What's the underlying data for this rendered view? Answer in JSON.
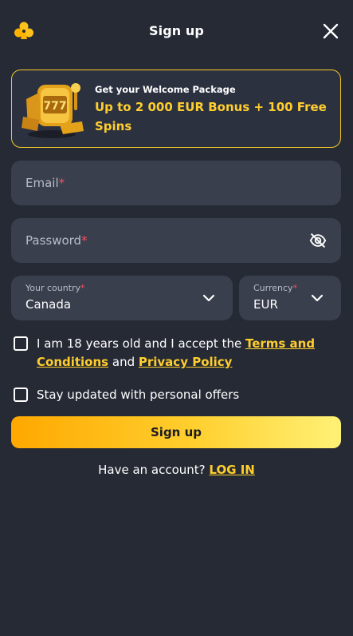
{
  "header": {
    "title": "Sign up",
    "logo_icon": "club-suit-logo-icon",
    "close_icon": "close-icon"
  },
  "promo": {
    "subtitle": "Get your Welcome Package",
    "headline": "Up to 2 000 EUR Bonus + 100 Free Spins",
    "art_icon": "golden-777-slot-machine-icon",
    "accent_color": "#ffce2e"
  },
  "form": {
    "email": {
      "label": "Email",
      "required_mark": "*"
    },
    "password": {
      "label": "Password",
      "required_mark": "*",
      "toggle_icon": "eye-off-icon"
    },
    "country": {
      "label": "Your country",
      "required_mark": "*",
      "value": "Canada"
    },
    "currency": {
      "label": "Currency",
      "required_mark": "*",
      "value": "EUR"
    },
    "terms": {
      "text_before": "I am 18 years old and I accept the ",
      "terms_link": "Terms and Conditions",
      "text_middle": " and ",
      "privacy_link": "Privacy Policy",
      "checked": false
    },
    "offers": {
      "text": "Stay updated with personal offers",
      "checked": false
    },
    "submit_label": "Sign up"
  },
  "footer": {
    "question": "Have an account? ",
    "login_link": "LOG IN"
  },
  "colors": {
    "background": "#262a35",
    "field_background": "#3a3f4d",
    "required": "#ff4d5e",
    "link": "#ffce2e"
  }
}
